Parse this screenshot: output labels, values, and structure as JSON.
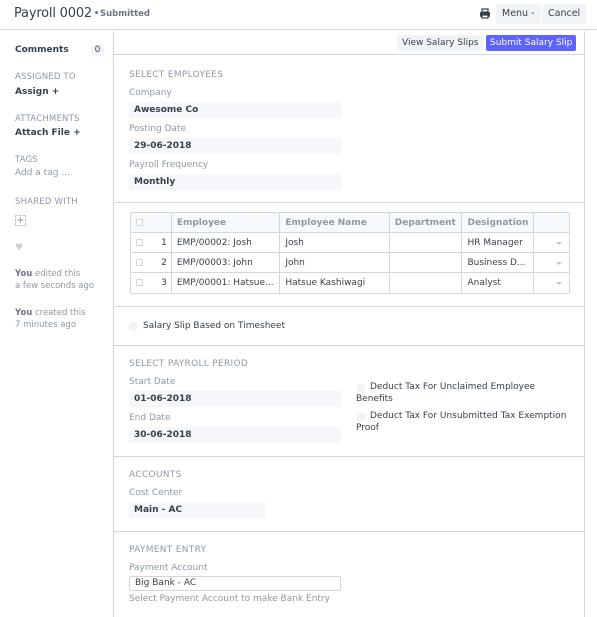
{
  "header": {
    "title": "Payroll 0002",
    "status": "Submitted",
    "status_color": "#5e64ff",
    "print_icon": "print-icon",
    "menu_label": "Menu -",
    "cancel_label": "Cancel"
  },
  "sidebar": {
    "comments_label": "Comments",
    "comments_count": "0",
    "assigned_to_head": "ASSIGNED TO",
    "assign_link": "Assign +",
    "attachments_head": "ATTACHMENTS",
    "attach_link": "Attach File +",
    "tags_head": "TAGS",
    "add_tag": "Add a tag ...",
    "shared_head": "SHARED WITH",
    "share_icon": "+",
    "heart_icon": "♥",
    "activity": [
      {
        "who": "You",
        "what": " edited this",
        "when": "a few seconds ago"
      },
      {
        "who": "You",
        "what": " created this",
        "when": "7 minutes ago"
      }
    ]
  },
  "toolbar": {
    "view_slips": "View Salary Slips",
    "submit_slip": "Submit Salary Slip",
    "primary_color": "#5e64ff"
  },
  "select_employees": {
    "heading": "SELECT EMPLOYEES",
    "company_label": "Company",
    "company_value": "Awesome Co",
    "posting_date_label": "Posting Date",
    "posting_date_value": "29-06-2018",
    "frequency_label": "Payroll Frequency",
    "frequency_value": "Monthly"
  },
  "employees_table": {
    "columns": [
      "Employee",
      "Employee Name",
      "Department",
      "Designation"
    ],
    "rows": [
      {
        "idx": "1",
        "employee": "EMP/00002: Josh",
        "name": "Josh",
        "department": "",
        "designation": "HR Manager"
      },
      {
        "idx": "2",
        "employee": "EMP/00003: John",
        "name": "John",
        "department": "",
        "designation": "Business D..."
      },
      {
        "idx": "3",
        "employee": "EMP/00001: Hatsue...",
        "name": "Hatsue Kashiwagi",
        "department": "",
        "designation": "Analyst"
      }
    ]
  },
  "timesheet": {
    "label": "Salary Slip Based on Timesheet",
    "checked": false
  },
  "payroll_period": {
    "heading": "SELECT PAYROLL PERIOD",
    "start_label": "Start Date",
    "start_value": "01-06-2018",
    "end_label": "End Date",
    "end_value": "30-06-2018",
    "deduct_unclaimed_line1": "Deduct Tax For Unclaimed Employee",
    "deduct_unclaimed_line2": "Benefits",
    "deduct_unsubmitted_line1": "Deduct Tax For Unsubmitted Tax Exemption",
    "deduct_unsubmitted_line2": "Proof"
  },
  "accounts": {
    "heading": "ACCOUNTS",
    "cost_center_label": "Cost Center",
    "cost_center_value": "Main - AC"
  },
  "payment_entry": {
    "heading": "PAYMENT ENTRY",
    "account_label": "Payment Account",
    "account_value": "Big Bank - AC",
    "help": "Select Payment Account to make Bank Entry"
  }
}
